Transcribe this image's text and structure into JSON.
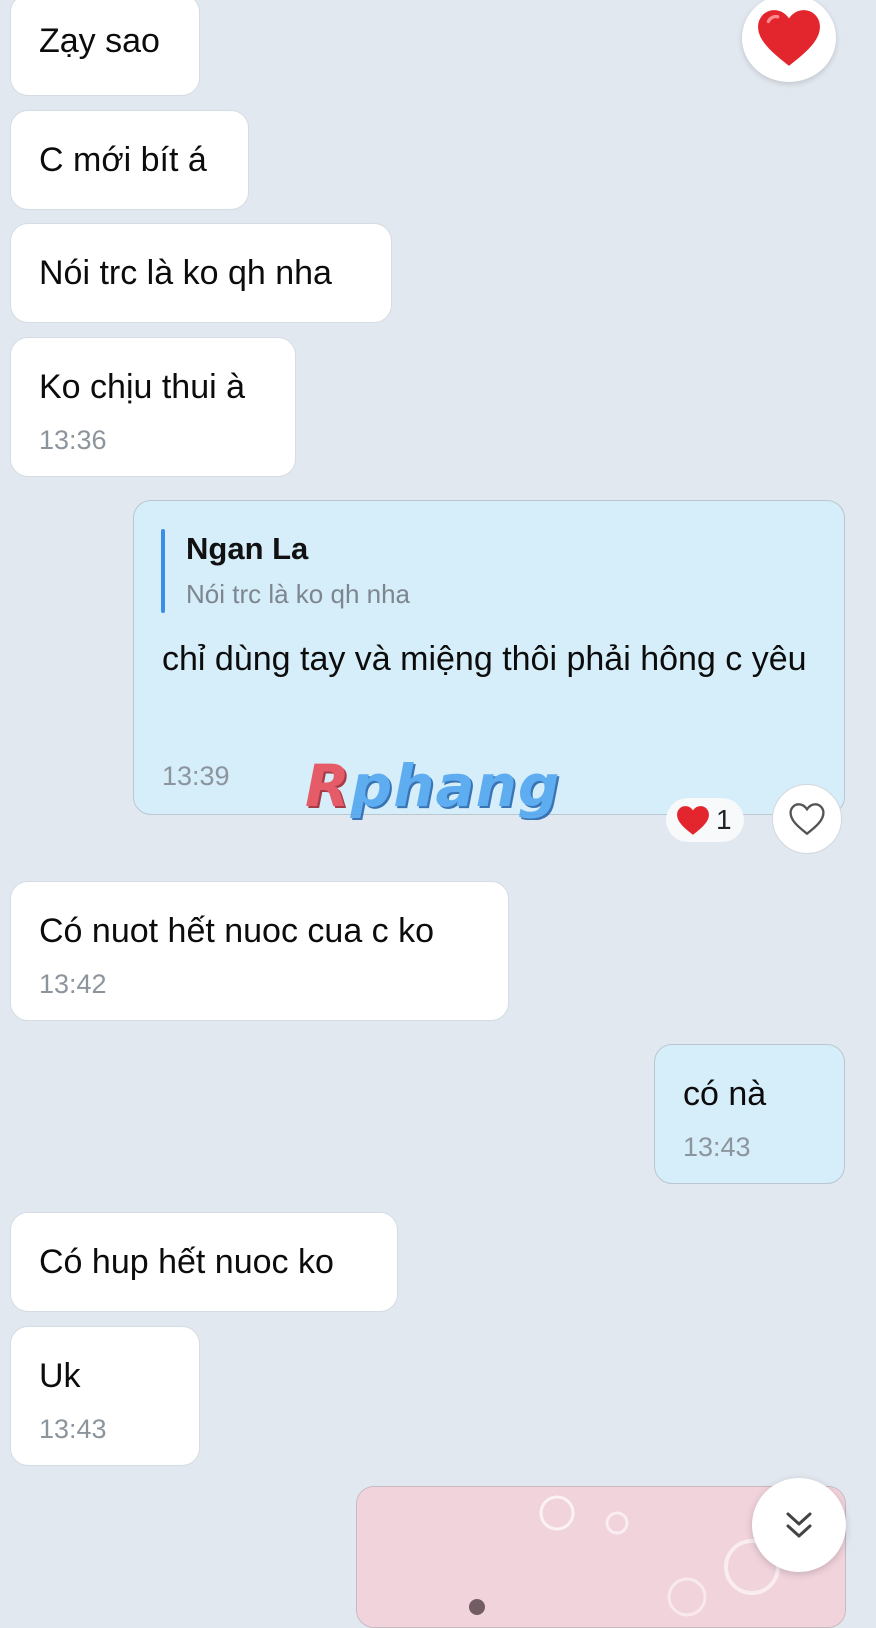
{
  "messages": [
    {
      "text": "Zạy sao"
    },
    {
      "text": "C mới bít á"
    },
    {
      "text": "Nói trc là ko qh nha"
    },
    {
      "text": "Ko chịu thui à",
      "time": "13:36"
    },
    {
      "reply_to": {
        "name": "Ngan La",
        "text": "Nói trc là ko qh nha"
      },
      "text": "chỉ dùng tay và miệng thôi phải hông c yêu",
      "time": "13:39"
    },
    {
      "text": "Có nuot hết nuoc cua c ko",
      "time": "13:42"
    },
    {
      "text": "có nà",
      "time": "13:43"
    },
    {
      "text": "Có hup hết nuoc ko"
    },
    {
      "text": "Uk",
      "time": "13:43"
    }
  ],
  "reaction": {
    "emoji": "❤",
    "count": "1"
  },
  "watermark": {
    "first": "R",
    "rest": "phang"
  },
  "icons": {
    "top_reaction": "heart-emoji-icon",
    "like_button": "heart-outline-icon",
    "scroll_down": "double-chevron-down-icon"
  },
  "colors": {
    "background": "#e2e8ef",
    "incoming_bubble": "#ffffff",
    "outgoing_bubble": "#d6edfa",
    "quote_bar": "#3a8ee6",
    "heart": "#e3262e"
  }
}
